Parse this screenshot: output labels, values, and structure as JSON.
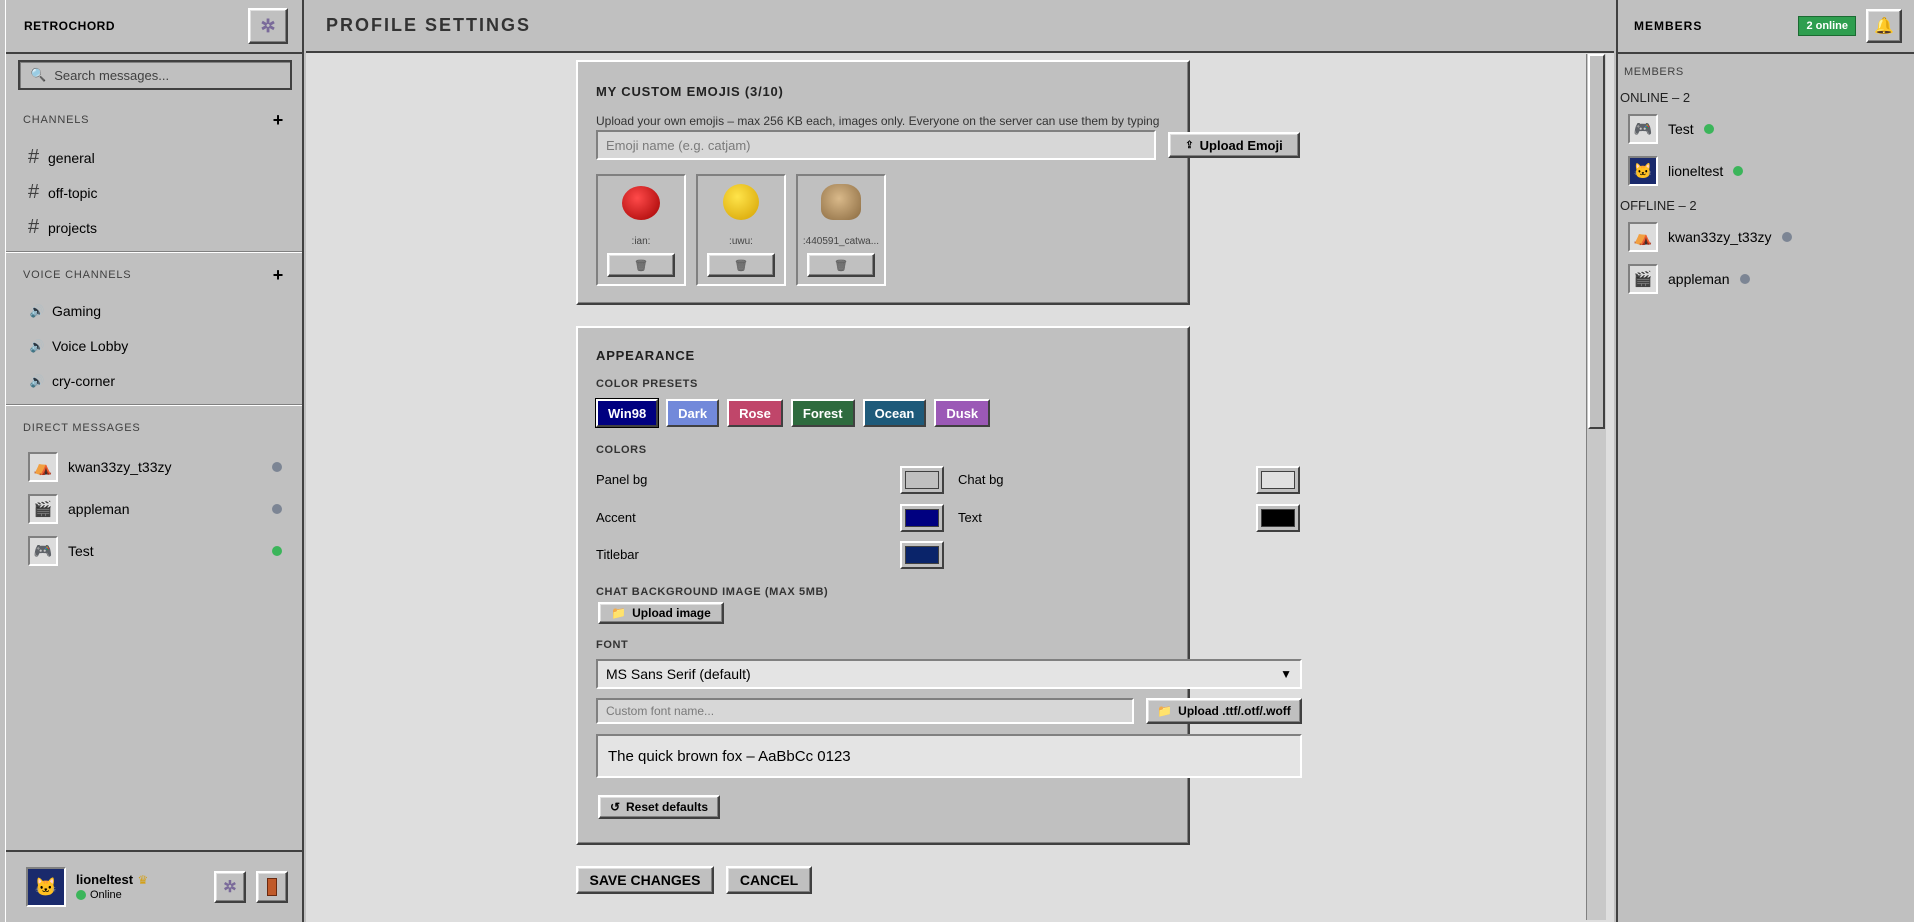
{
  "app": {
    "name": "RETROCHORD"
  },
  "sidebar": {
    "search_placeholder": "Search messages...",
    "channels_header": "CHANNELS",
    "channels": [
      {
        "name": "general"
      },
      {
        "name": "off-topic"
      },
      {
        "name": "projects"
      }
    ],
    "voice_header": "VOICE CHANNELS",
    "voice_channels": [
      {
        "name": "Gaming"
      },
      {
        "name": "Voice Lobby"
      },
      {
        "name": "cry-corner"
      }
    ],
    "dm_header": "DIRECT MESSAGES",
    "dms": [
      {
        "name": "kwan33zy_t33zy",
        "status": "offline",
        "avatar_icon": "tent-icon"
      },
      {
        "name": "appleman",
        "status": "offline",
        "avatar_icon": "clapper-icon"
      },
      {
        "name": "Test",
        "status": "online",
        "avatar_icon": "gamepad-icon"
      }
    ],
    "user": {
      "name": "lioneltest",
      "status": "Online",
      "badge_icon": "crown-icon"
    }
  },
  "main": {
    "title": "PROFILE SETTINGS",
    "emojis": {
      "title": "MY CUSTOM EMOJIS (3/10)",
      "description": "Upload your own emojis – max 256 KB each, images only. Everyone on the server can use them by typing :name:",
      "name_placeholder": "Emoji name (e.g. catjam)",
      "upload_label": "Upload Emoji",
      "items": [
        {
          "label": ":ian:",
          "icon": "red-blob-icon"
        },
        {
          "label": ":uwu:",
          "icon": "thinking-face-icon"
        },
        {
          "label": ":440591_catwa...",
          "icon": "cat-thumbs-up-icon"
        }
      ]
    },
    "appearance": {
      "title": "APPEARANCE",
      "presets_header": "COLOR PRESETS",
      "presets": [
        {
          "label": "Win98",
          "color": "#000080"
        },
        {
          "label": "Dark",
          "color": "#7289da"
        },
        {
          "label": "Rose",
          "color": "#c0466a"
        },
        {
          "label": "Forest",
          "color": "#2e6b3e"
        },
        {
          "label": "Ocean",
          "color": "#1e5a7a"
        },
        {
          "label": "Dusk",
          "color": "#9b59b6"
        }
      ],
      "colors_header": "COLORS",
      "colors": {
        "panel_bg": {
          "label": "Panel bg",
          "value": "#c0c0c0"
        },
        "chat_bg": {
          "label": "Chat bg",
          "value": "#e0e0e0"
        },
        "accent": {
          "label": "Accent",
          "value": "#000080"
        },
        "text": {
          "label": "Text",
          "value": "#000000"
        },
        "titlebar": {
          "label": "Titlebar",
          "value": "#0a246a"
        }
      },
      "bg_image_header": "CHAT BACKGROUND IMAGE (MAX 5MB)",
      "upload_image_label": "Upload image",
      "font_header": "FONT",
      "font_selected": "MS Sans Serif (default)",
      "custom_font_placeholder": "Custom font name...",
      "upload_font_label": "Upload .ttf/.otf/.woff",
      "font_preview": "The quick brown fox – AaBbCc 0123",
      "reset_label": "Reset defaults"
    },
    "save_label": "SAVE CHANGES",
    "cancel_label": "CANCEL"
  },
  "members": {
    "title": "MEMBERS",
    "online_badge": "2 online",
    "subheader": "MEMBERS",
    "online_group": "ONLINE – 2",
    "offline_group": "OFFLINE – 2",
    "online": [
      {
        "name": "Test",
        "icon": "gamepad-icon"
      },
      {
        "name": "lioneltest",
        "icon": "nyan-cat-icon"
      }
    ],
    "offline": [
      {
        "name": "kwan33zy_t33zy",
        "icon": "tent-icon"
      },
      {
        "name": "appleman",
        "icon": "clapper-icon"
      }
    ]
  }
}
